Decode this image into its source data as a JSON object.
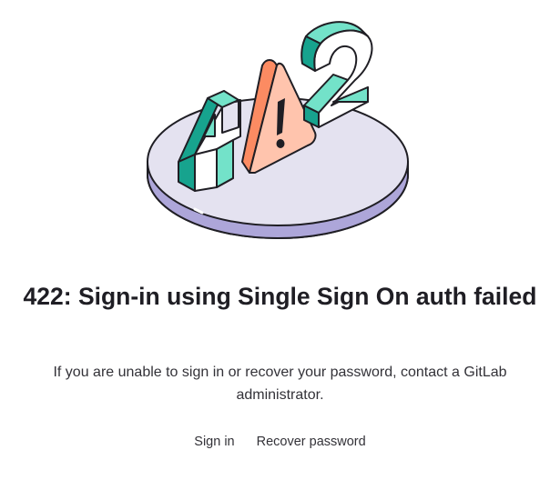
{
  "illustration": {
    "digits": [
      "4",
      "2"
    ],
    "warning_symbol": "!",
    "colors": {
      "platform_top": "#e4e2f0",
      "platform_side": "#ada6d9",
      "teal_digit": "#73e2c9",
      "teal_digit_dark": "#17a38e",
      "warning_orange": "#fc8b62",
      "warning_peach": "#ffc4ad",
      "outline": "#1f1e24"
    }
  },
  "error": {
    "title": "422: Sign-in using Single Sign On auth failed",
    "message": "If you are unable to sign in or recover your password, contact a GitLab administrator."
  },
  "actions": {
    "sign_in": "Sign in",
    "recover_password": "Recover password"
  }
}
